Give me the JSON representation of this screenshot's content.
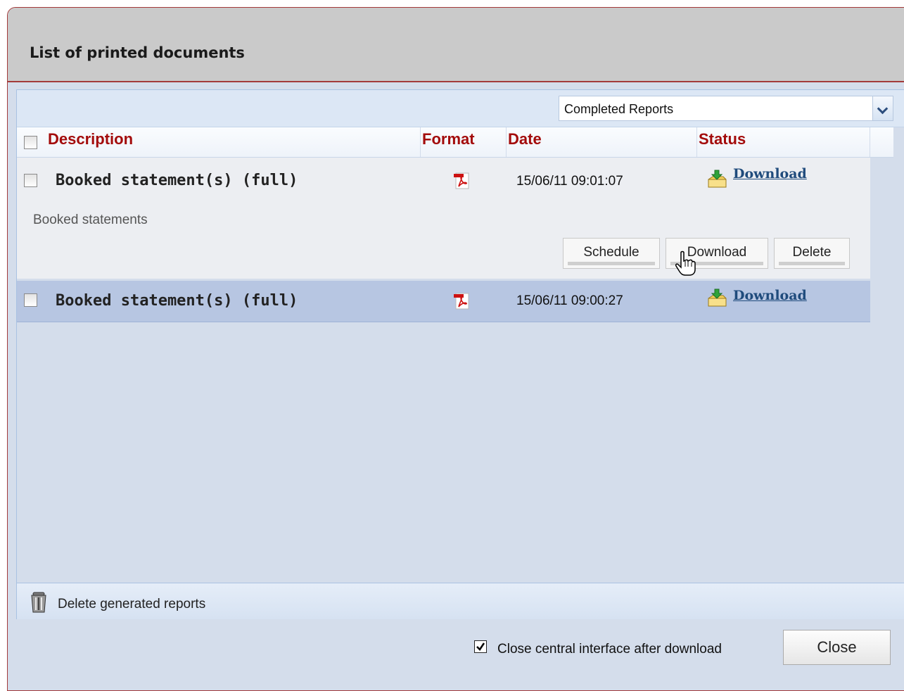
{
  "window": {
    "title": "List of printed documents"
  },
  "filter": {
    "selected": "Completed Reports"
  },
  "columns": {
    "description": "Description",
    "format": "Format",
    "date": "Date",
    "status": "Status"
  },
  "rows": [
    {
      "title": "Booked statement(s) (full)",
      "format_icon": "pdf-icon",
      "date": "15/06/11 09:01:07",
      "status_link": "Download",
      "description": "Booked statements",
      "actions": {
        "schedule": "Schedule",
        "download": "Download",
        "delete": "Delete"
      }
    },
    {
      "title": "Booked statement(s) (full)",
      "format_icon": "pdf-icon",
      "date": "15/06/11 09:00:27",
      "status_link": "Download"
    }
  ],
  "footer": {
    "delete_all": "Delete generated reports"
  },
  "bottom": {
    "close_after_download_label": "Close central interface after download",
    "close_after_download_checked": true,
    "close_button": "Close"
  },
  "colors": {
    "accent_red": "#a30b0b",
    "link_blue": "#1f4b7c",
    "panel_bg": "#d4ddeb",
    "selected_row": "#b7c6e2"
  }
}
